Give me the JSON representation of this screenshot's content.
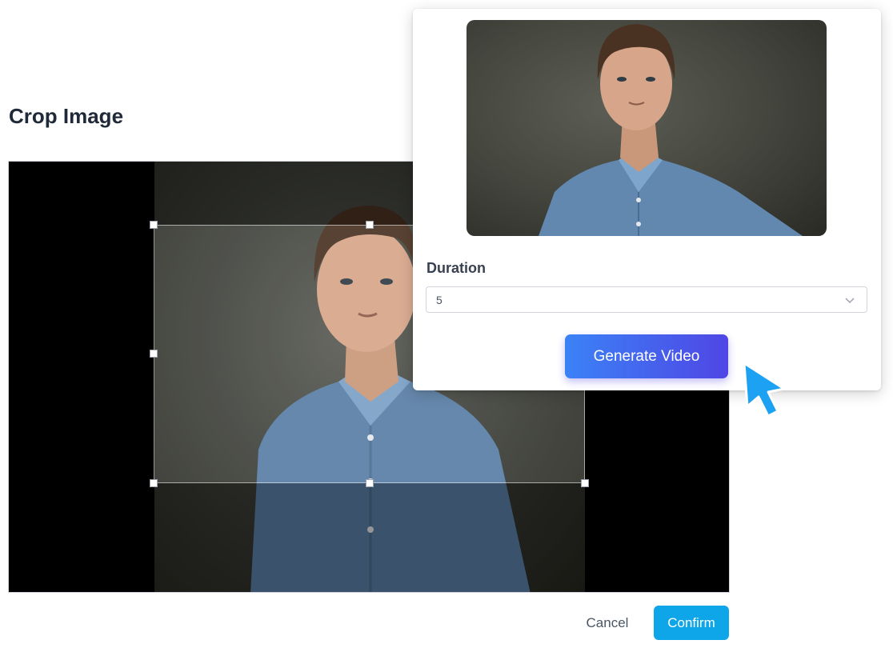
{
  "crop_dialog": {
    "title": "Crop Image",
    "cancel_label": "Cancel",
    "confirm_label": "Confirm"
  },
  "video_panel": {
    "duration_label": "Duration",
    "duration_value": "5",
    "generate_label": "Generate Video"
  },
  "icons": {
    "dropdown": "chevron-down-icon",
    "cursor": "mouse-pointer-icon"
  },
  "colors": {
    "confirm_bg": "#0ea5e9",
    "generate_gradient_start": "#3b82f6",
    "generate_gradient_end": "#4f46e5",
    "cursor": "#1da1f2"
  }
}
